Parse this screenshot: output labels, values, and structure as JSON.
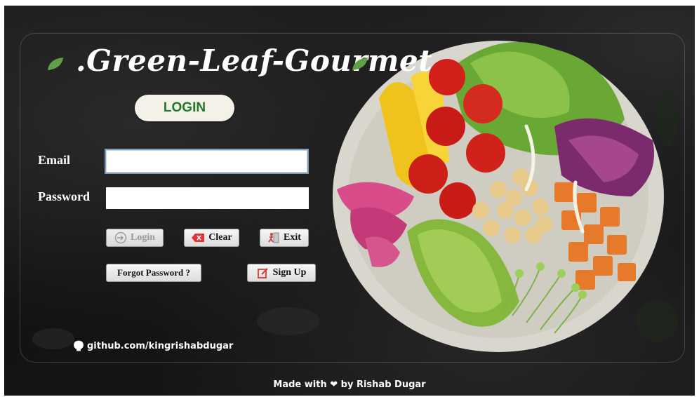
{
  "app": {
    "brand_title": ".Green-Leaf-Gourmet",
    "header_badge": "LOGIN"
  },
  "form": {
    "email_label": "Email",
    "email_value": "",
    "password_label": "Password",
    "password_value": ""
  },
  "buttons": {
    "login": "Login",
    "clear": "Clear",
    "exit": "Exit",
    "forgot_password": "Forgot Password ?",
    "sign_up": "Sign Up"
  },
  "links": {
    "github": "github.com/kingrishabdugar"
  },
  "footer": {
    "made_with": "Made with ❤ by Rishab Dugar"
  },
  "colors": {
    "background": "#151515",
    "brand_green": "#1f7a2c",
    "leaf_green": "#5fa046",
    "exit_red": "#d63a3a",
    "clear_red": "#e0353a"
  },
  "icons": {
    "login": "login-arrow-icon",
    "clear": "eraser-icon",
    "exit": "exit-door-icon",
    "sign_up": "edit-square-icon",
    "github": "github-icon",
    "leaf": "leaf-icon"
  }
}
